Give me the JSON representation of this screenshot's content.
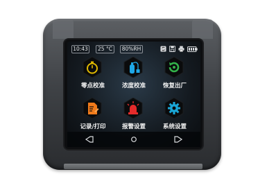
{
  "status": {
    "time": "10:43",
    "temperature": "25 °C",
    "humidity": "80%RH",
    "icons": [
      "sync-icon",
      "save-icon",
      "printer-icon",
      "battery-icon"
    ]
  },
  "tiles": [
    {
      "label": "零点校准",
      "icon": "stopwatch-icon",
      "color": "#e0b900"
    },
    {
      "label": "浓度校准",
      "icon": "gas-bottle-icon",
      "color": "#1ea7e6"
    },
    {
      "label": "恢复出厂",
      "icon": "refresh-icon",
      "color": "#33b34a"
    },
    {
      "label": "记录/打印",
      "icon": "document-edit-icon",
      "color": "#f07a1a"
    },
    {
      "label": "报警设置",
      "icon": "alarm-light-icon",
      "color": "#e52b2b"
    },
    {
      "label": "系统设置",
      "icon": "gear-icon",
      "color": "#1aa6d6"
    }
  ],
  "nav": [
    "back-icon",
    "home-icon",
    "forward-icon"
  ]
}
